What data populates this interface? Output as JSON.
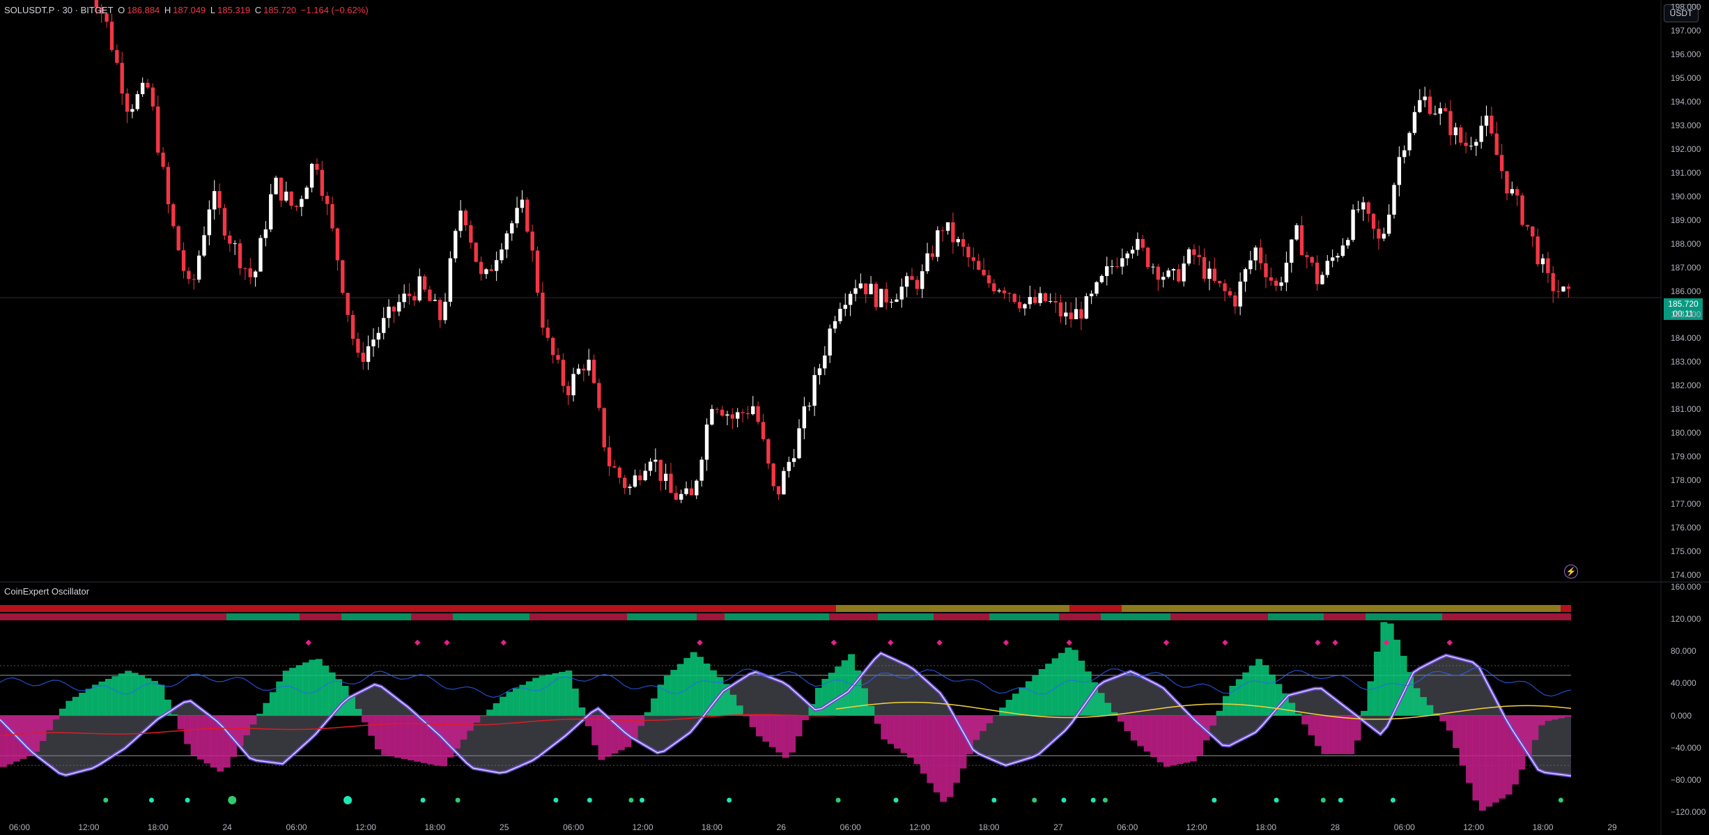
{
  "header": {
    "symbol": "SOLUSDT.P · 30 · BITGET",
    "open_label": "O",
    "open": "186.884",
    "high_label": "H",
    "high": "187.049",
    "low_label": "L",
    "low": "185.319",
    "close_label": "C",
    "close": "185.720",
    "change": "−1.164 (−0.62%)"
  },
  "indicator": {
    "title": "CoinExpert Oscillator"
  },
  "currency_button": "USDT",
  "last_price": {
    "price": "185.720",
    "countdown": "00:11"
  },
  "price_axis": [
    "198.000",
    "197.000",
    "196.000",
    "195.000",
    "194.000",
    "193.000",
    "192.000",
    "191.000",
    "190.000",
    "189.000",
    "188.000",
    "187.000",
    "186.000",
    "185.000",
    "184.000",
    "183.000",
    "182.000",
    "181.000",
    "180.000",
    "179.000",
    "178.000",
    "177.000",
    "176.000",
    "175.000",
    "174.000"
  ],
  "osc_axis": [
    "160.000",
    "120.000",
    "80.000",
    "40.000",
    "0.000",
    "−40.000",
    "−80.000",
    "−120.000"
  ],
  "time_axis": [
    "06:00",
    "12:00",
    "18:00",
    "24",
    "06:00",
    "12:00",
    "18:00",
    "25",
    "06:00",
    "12:00",
    "18:00",
    "26",
    "06:00",
    "12:00",
    "18:00",
    "27",
    "06:00",
    "12:00",
    "18:00",
    "28",
    "06:00",
    "12:00",
    "18:00",
    "29"
  ],
  "colors": {
    "up": "#ffffff",
    "down": "#f23645",
    "teal": "#089981",
    "bg": "#000000"
  },
  "icons": {
    "alert": "lightning-icon"
  },
  "chart_data": {
    "type": "candlestick",
    "series": [
      {
        "name": "SOLUSDT.P",
        "close_path": [
          199.5,
          197.2,
          193.8,
          194.6,
          189.2,
          185.8,
          190.1,
          188.0,
          186.4,
          190.6,
          189.4,
          191.7,
          187.6,
          183.0,
          184.3,
          185.5,
          186.2,
          184.8,
          189.8,
          186.2,
          188.4,
          189.6,
          184.0,
          181.8,
          183.2,
          178.8,
          177.6,
          179.2,
          177.4,
          177.2,
          181.5,
          180.6,
          181.2,
          177.2,
          179.6,
          182.4,
          185.5,
          186.5,
          185.6,
          186.1,
          186.5,
          188.8,
          187.7,
          186.4,
          186.2,
          185.4,
          185.6,
          184.8,
          185.4,
          186.9,
          188.2,
          187.2,
          186.4,
          187.6,
          186.3,
          185.6,
          187.8,
          186.1,
          188.4,
          186.4,
          187.8,
          189.6,
          187.9,
          192.1,
          194.2,
          193.4,
          192.1,
          193.2,
          190.6,
          188.8,
          186.4,
          185.7
        ]
      }
    ],
    "ylim": [
      173.7,
      198.3
    ]
  },
  "oscillator_data": {
    "type": "line",
    "ylim": [
      -126,
      166
    ],
    "levels": [
      50,
      0,
      -50
    ],
    "series": [
      {
        "path": [
          -5,
          -45,
          -75,
          -65,
          -40,
          -5,
          20,
          -10,
          -55,
          -60,
          -25,
          20,
          40,
          10,
          -25,
          -65,
          -72,
          -55,
          -25,
          10,
          -25,
          -48,
          -20,
          30,
          55,
          40,
          5,
          30,
          78,
          60,
          25,
          -45,
          -62,
          -50,
          -15,
          40,
          55,
          35,
          -5,
          -40,
          -20,
          25,
          35,
          5,
          -25,
          55,
          75,
          65,
          -10,
          -70,
          -75
        ]
      }
    ]
  }
}
